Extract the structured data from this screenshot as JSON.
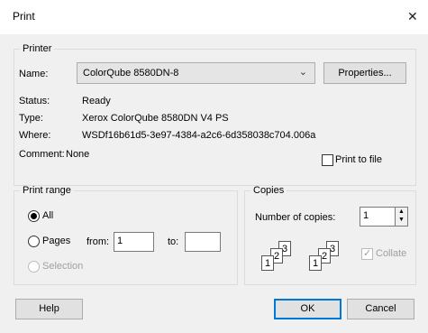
{
  "window": {
    "title": "Print",
    "close_glyph": "✕"
  },
  "printer": {
    "group_label": "Printer",
    "name_label": "Name:",
    "name_value": "ColorQube 8580DN-8",
    "properties_label": "Properties...",
    "status_label": "Status:",
    "status_value": "Ready",
    "type_label": "Type:",
    "type_value": "Xerox ColorQube 8580DN V4 PS",
    "where_label": "Where:",
    "where_value": "WSDf16b61d5-3e97-4384-a2c6-6d358038c704.006a",
    "comment_label": "Comment:",
    "comment_value": "None",
    "print_to_file_label": "Print to file",
    "print_to_file_checked": false
  },
  "print_range": {
    "group_label": "Print range",
    "all_label": "All",
    "all_selected": true,
    "pages_label": "Pages",
    "from_label": "from:",
    "from_value": "1",
    "to_label": "to:",
    "to_value": "",
    "selection_label": "Selection"
  },
  "copies": {
    "group_label": "Copies",
    "number_label": "Number of copies:",
    "number_value": "1",
    "collate_label": "Collate",
    "collate_checked": true,
    "collate_pages": [
      "1",
      "2",
      "3"
    ]
  },
  "buttons": {
    "help": "Help",
    "ok": "OK",
    "cancel": "Cancel"
  }
}
